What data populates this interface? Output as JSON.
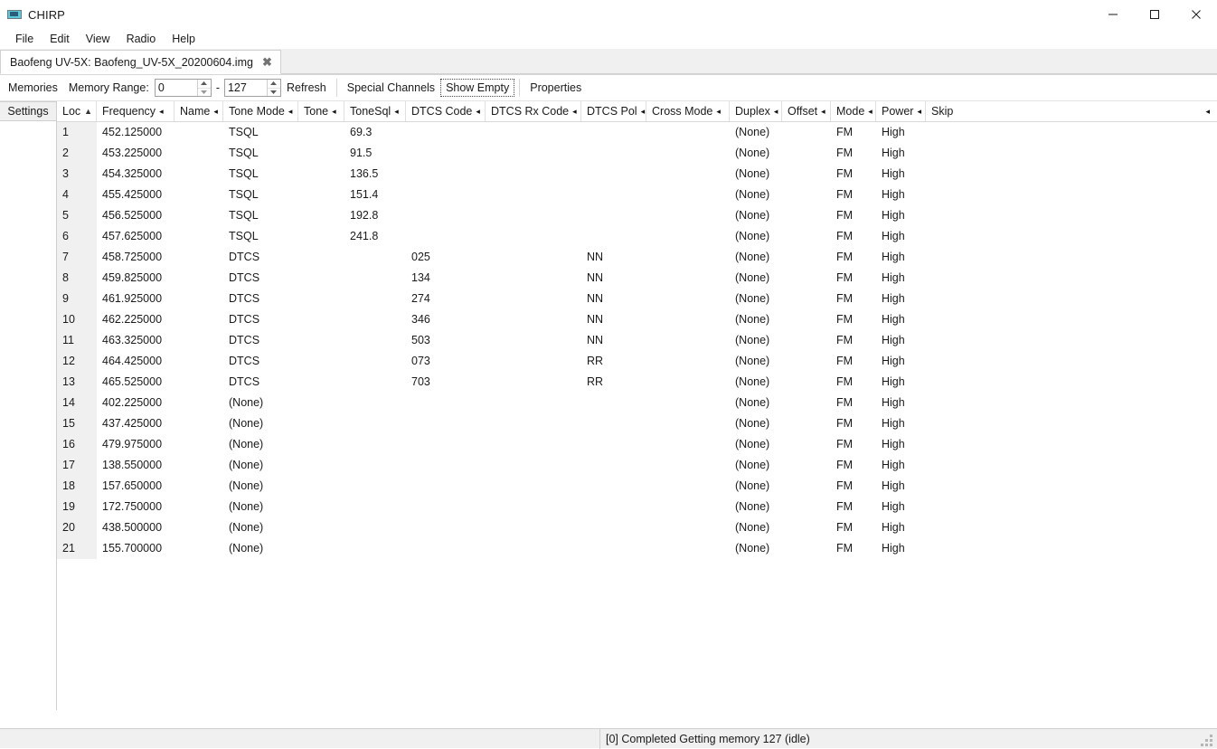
{
  "window": {
    "title": "CHIRP",
    "icon": "radio-icon",
    "controls": {
      "minimize": "minimize-icon",
      "maximize": "maximize-icon",
      "close": "close-icon"
    }
  },
  "menubar": {
    "items": [
      {
        "label": "File"
      },
      {
        "label": "Edit"
      },
      {
        "label": "View"
      },
      {
        "label": "Radio"
      },
      {
        "label": "Help"
      }
    ]
  },
  "tabs": [
    {
      "label": "Baofeng UV-5X: Baofeng_UV-5X_20200604.img",
      "close": "✖",
      "active": true
    }
  ],
  "toolbar": {
    "memories_label": "Memories",
    "memory_range_label": "Memory Range:",
    "range_start": "0",
    "range_end": "127",
    "dash": "-",
    "refresh_label": "Refresh",
    "special_channels_label": "Special Channels",
    "show_empty_label": "Show Empty",
    "properties_label": "Properties"
  },
  "sidebar": {
    "settings_label": "Settings"
  },
  "grid": {
    "overflow_marker": "◂",
    "columns": [
      {
        "label": "Loc",
        "width": 44,
        "marker": "▲",
        "marker_kind": "sort-asc",
        "align": "left"
      },
      {
        "label": "Frequency",
        "width": 86,
        "marker": "◂",
        "marker_kind": "filter",
        "align": "left"
      },
      {
        "label": "Name",
        "width": 54,
        "marker": "◂",
        "marker_kind": "filter",
        "align": "left"
      },
      {
        "label": "Tone Mode",
        "width": 83,
        "marker": "◂",
        "marker_kind": "filter",
        "align": "left"
      },
      {
        "label": "Tone",
        "width": 51,
        "marker": "◂",
        "marker_kind": "filter",
        "align": "left"
      },
      {
        "label": "ToneSql",
        "width": 68,
        "marker": "◂",
        "marker_kind": "filter",
        "align": "left"
      },
      {
        "label": "DTCS Code",
        "width": 88,
        "marker": "◂",
        "marker_kind": "filter",
        "align": "left"
      },
      {
        "label": "DTCS Rx Code",
        "width": 106,
        "marker": "◂",
        "marker_kind": "filter",
        "align": "left"
      },
      {
        "label": "DTCS Pol",
        "width": 72,
        "marker": "◂",
        "marker_kind": "filter",
        "align": "left"
      },
      {
        "label": "Cross Mode",
        "width": 92,
        "marker": "◂",
        "marker_kind": "filter",
        "align": "left"
      },
      {
        "label": "Duplex",
        "width": 58,
        "marker": "◂",
        "marker_kind": "filter",
        "align": "left"
      },
      {
        "label": "Offset",
        "width": 54,
        "marker": "◂",
        "marker_kind": "filter",
        "align": "left"
      },
      {
        "label": "Mode",
        "width": 50,
        "marker": "◂",
        "marker_kind": "filter",
        "align": "left"
      },
      {
        "label": "Power",
        "width": 55,
        "marker": "◂",
        "marker_kind": "filter",
        "align": "left"
      },
      {
        "label": "Skip",
        "width": 60,
        "marker": "",
        "marker_kind": "none",
        "align": "left"
      }
    ],
    "rows": [
      {
        "loc": "1",
        "frequency": "452.125000",
        "name": "",
        "tone_mode": "TSQL",
        "tone": "",
        "tonesql": "69.3",
        "dtcs_code": "",
        "dtcs_rx_code": "",
        "dtcs_pol": "",
        "cross_mode": "",
        "duplex": "(None)",
        "offset": "",
        "mode": "FM",
        "power": "High",
        "skip": ""
      },
      {
        "loc": "2",
        "frequency": "453.225000",
        "name": "",
        "tone_mode": "TSQL",
        "tone": "",
        "tonesql": "91.5",
        "dtcs_code": "",
        "dtcs_rx_code": "",
        "dtcs_pol": "",
        "cross_mode": "",
        "duplex": "(None)",
        "offset": "",
        "mode": "FM",
        "power": "High",
        "skip": ""
      },
      {
        "loc": "3",
        "frequency": "454.325000",
        "name": "",
        "tone_mode": "TSQL",
        "tone": "",
        "tonesql": "136.5",
        "dtcs_code": "",
        "dtcs_rx_code": "",
        "dtcs_pol": "",
        "cross_mode": "",
        "duplex": "(None)",
        "offset": "",
        "mode": "FM",
        "power": "High",
        "skip": ""
      },
      {
        "loc": "4",
        "frequency": "455.425000",
        "name": "",
        "tone_mode": "TSQL",
        "tone": "",
        "tonesql": "151.4",
        "dtcs_code": "",
        "dtcs_rx_code": "",
        "dtcs_pol": "",
        "cross_mode": "",
        "duplex": "(None)",
        "offset": "",
        "mode": "FM",
        "power": "High",
        "skip": ""
      },
      {
        "loc": "5",
        "frequency": "456.525000",
        "name": "",
        "tone_mode": "TSQL",
        "tone": "",
        "tonesql": "192.8",
        "dtcs_code": "",
        "dtcs_rx_code": "",
        "dtcs_pol": "",
        "cross_mode": "",
        "duplex": "(None)",
        "offset": "",
        "mode": "FM",
        "power": "High",
        "skip": ""
      },
      {
        "loc": "6",
        "frequency": "457.625000",
        "name": "",
        "tone_mode": "TSQL",
        "tone": "",
        "tonesql": "241.8",
        "dtcs_code": "",
        "dtcs_rx_code": "",
        "dtcs_pol": "",
        "cross_mode": "",
        "duplex": "(None)",
        "offset": "",
        "mode": "FM",
        "power": "High",
        "skip": ""
      },
      {
        "loc": "7",
        "frequency": "458.725000",
        "name": "",
        "tone_mode": "DTCS",
        "tone": "",
        "tonesql": "",
        "dtcs_code": "025",
        "dtcs_rx_code": "",
        "dtcs_pol": "NN",
        "cross_mode": "",
        "duplex": "(None)",
        "offset": "",
        "mode": "FM",
        "power": "High",
        "skip": ""
      },
      {
        "loc": "8",
        "frequency": "459.825000",
        "name": "",
        "tone_mode": "DTCS",
        "tone": "",
        "tonesql": "",
        "dtcs_code": "134",
        "dtcs_rx_code": "",
        "dtcs_pol": "NN",
        "cross_mode": "",
        "duplex": "(None)",
        "offset": "",
        "mode": "FM",
        "power": "High",
        "skip": ""
      },
      {
        "loc": "9",
        "frequency": "461.925000",
        "name": "",
        "tone_mode": "DTCS",
        "tone": "",
        "tonesql": "",
        "dtcs_code": "274",
        "dtcs_rx_code": "",
        "dtcs_pol": "NN",
        "cross_mode": "",
        "duplex": "(None)",
        "offset": "",
        "mode": "FM",
        "power": "High",
        "skip": ""
      },
      {
        "loc": "10",
        "frequency": "462.225000",
        "name": "",
        "tone_mode": "DTCS",
        "tone": "",
        "tonesql": "",
        "dtcs_code": "346",
        "dtcs_rx_code": "",
        "dtcs_pol": "NN",
        "cross_mode": "",
        "duplex": "(None)",
        "offset": "",
        "mode": "FM",
        "power": "High",
        "skip": ""
      },
      {
        "loc": "11",
        "frequency": "463.325000",
        "name": "",
        "tone_mode": "DTCS",
        "tone": "",
        "tonesql": "",
        "dtcs_code": "503",
        "dtcs_rx_code": "",
        "dtcs_pol": "NN",
        "cross_mode": "",
        "duplex": "(None)",
        "offset": "",
        "mode": "FM",
        "power": "High",
        "skip": ""
      },
      {
        "loc": "12",
        "frequency": "464.425000",
        "name": "",
        "tone_mode": "DTCS",
        "tone": "",
        "tonesql": "",
        "dtcs_code": "073",
        "dtcs_rx_code": "",
        "dtcs_pol": "RR",
        "cross_mode": "",
        "duplex": "(None)",
        "offset": "",
        "mode": "FM",
        "power": "High",
        "skip": ""
      },
      {
        "loc": "13",
        "frequency": "465.525000",
        "name": "",
        "tone_mode": "DTCS",
        "tone": "",
        "tonesql": "",
        "dtcs_code": "703",
        "dtcs_rx_code": "",
        "dtcs_pol": "RR",
        "cross_mode": "",
        "duplex": "(None)",
        "offset": "",
        "mode": "FM",
        "power": "High",
        "skip": ""
      },
      {
        "loc": "14",
        "frequency": "402.225000",
        "name": "",
        "tone_mode": "(None)",
        "tone": "",
        "tonesql": "",
        "dtcs_code": "",
        "dtcs_rx_code": "",
        "dtcs_pol": "",
        "cross_mode": "",
        "duplex": "(None)",
        "offset": "",
        "mode": "FM",
        "power": "High",
        "skip": ""
      },
      {
        "loc": "15",
        "frequency": "437.425000",
        "name": "",
        "tone_mode": "(None)",
        "tone": "",
        "tonesql": "",
        "dtcs_code": "",
        "dtcs_rx_code": "",
        "dtcs_pol": "",
        "cross_mode": "",
        "duplex": "(None)",
        "offset": "",
        "mode": "FM",
        "power": "High",
        "skip": ""
      },
      {
        "loc": "16",
        "frequency": "479.975000",
        "name": "",
        "tone_mode": "(None)",
        "tone": "",
        "tonesql": "",
        "dtcs_code": "",
        "dtcs_rx_code": "",
        "dtcs_pol": "",
        "cross_mode": "",
        "duplex": "(None)",
        "offset": "",
        "mode": "FM",
        "power": "High",
        "skip": ""
      },
      {
        "loc": "17",
        "frequency": "138.550000",
        "name": "",
        "tone_mode": "(None)",
        "tone": "",
        "tonesql": "",
        "dtcs_code": "",
        "dtcs_rx_code": "",
        "dtcs_pol": "",
        "cross_mode": "",
        "duplex": "(None)",
        "offset": "",
        "mode": "FM",
        "power": "High",
        "skip": ""
      },
      {
        "loc": "18",
        "frequency": "157.650000",
        "name": "",
        "tone_mode": "(None)",
        "tone": "",
        "tonesql": "",
        "dtcs_code": "",
        "dtcs_rx_code": "",
        "dtcs_pol": "",
        "cross_mode": "",
        "duplex": "(None)",
        "offset": "",
        "mode": "FM",
        "power": "High",
        "skip": ""
      },
      {
        "loc": "19",
        "frequency": "172.750000",
        "name": "",
        "tone_mode": "(None)",
        "tone": "",
        "tonesql": "",
        "dtcs_code": "",
        "dtcs_rx_code": "",
        "dtcs_pol": "",
        "cross_mode": "",
        "duplex": "(None)",
        "offset": "",
        "mode": "FM",
        "power": "High",
        "skip": ""
      },
      {
        "loc": "20",
        "frequency": "438.500000",
        "name": "",
        "tone_mode": "(None)",
        "tone": "",
        "tonesql": "",
        "dtcs_code": "",
        "dtcs_rx_code": "",
        "dtcs_pol": "",
        "cross_mode": "",
        "duplex": "(None)",
        "offset": "",
        "mode": "FM",
        "power": "High",
        "skip": ""
      },
      {
        "loc": "21",
        "frequency": "155.700000",
        "name": "",
        "tone_mode": "(None)",
        "tone": "",
        "tonesql": "",
        "dtcs_code": "",
        "dtcs_rx_code": "",
        "dtcs_pol": "",
        "cross_mode": "",
        "duplex": "(None)",
        "offset": "",
        "mode": "FM",
        "power": "High",
        "skip": ""
      }
    ]
  },
  "statusbar": {
    "left_section": "",
    "message": "[0] Completed Getting memory 127 (idle)"
  },
  "colors": {
    "window_bg": "#ffffff",
    "chrome_bg": "#f0f0f0",
    "border": "#d0d0d0",
    "text": "#1a1a1a",
    "loc_column_bg": "#f0f0f0"
  }
}
